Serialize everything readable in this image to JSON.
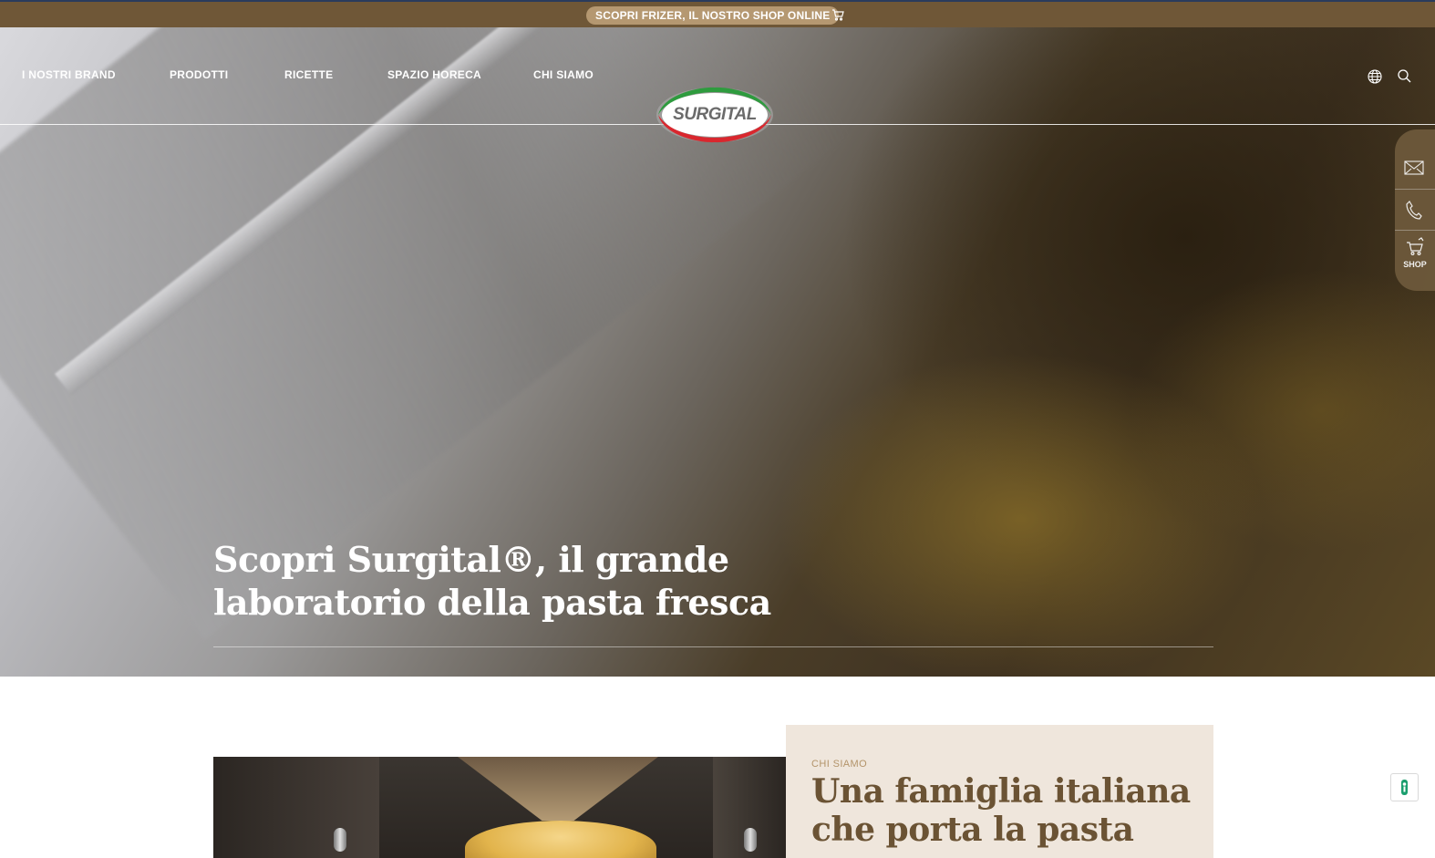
{
  "promo": {
    "label": "SCOPRI FRIZER, IL NOSTRO SHOP ONLINE",
    "icon": "cart-icon"
  },
  "nav": {
    "items": [
      {
        "label": "I NOSTRI BRAND"
      },
      {
        "label": "PRODOTTI"
      },
      {
        "label": "RICETTE"
      },
      {
        "label": "SPAZIO HORECA"
      },
      {
        "label": "CHI SIAMO"
      }
    ],
    "icons": [
      "globe-icon",
      "search-icon"
    ]
  },
  "logo": {
    "text": "SURGITAL",
    "colors": {
      "green": "#2e9b3e",
      "red": "#d9272e"
    }
  },
  "side_panel": {
    "icons": [
      "mail-icon",
      "phone-icon",
      "cart-icon"
    ],
    "shop_label": "SHOP"
  },
  "hero": {
    "title": "Scopri Surgital®, il grande laboratorio della pasta fresca"
  },
  "about": {
    "eyebrow": "CHI SIAMO",
    "title": "Una famiglia italiana che porta la pasta"
  },
  "colors": {
    "brand_brown": "#6f5737",
    "promo_pill": "#b59871",
    "card_bg": "#efe6dc",
    "card_title": "#6b5334",
    "accessibility_green": "#1a9e6e"
  }
}
